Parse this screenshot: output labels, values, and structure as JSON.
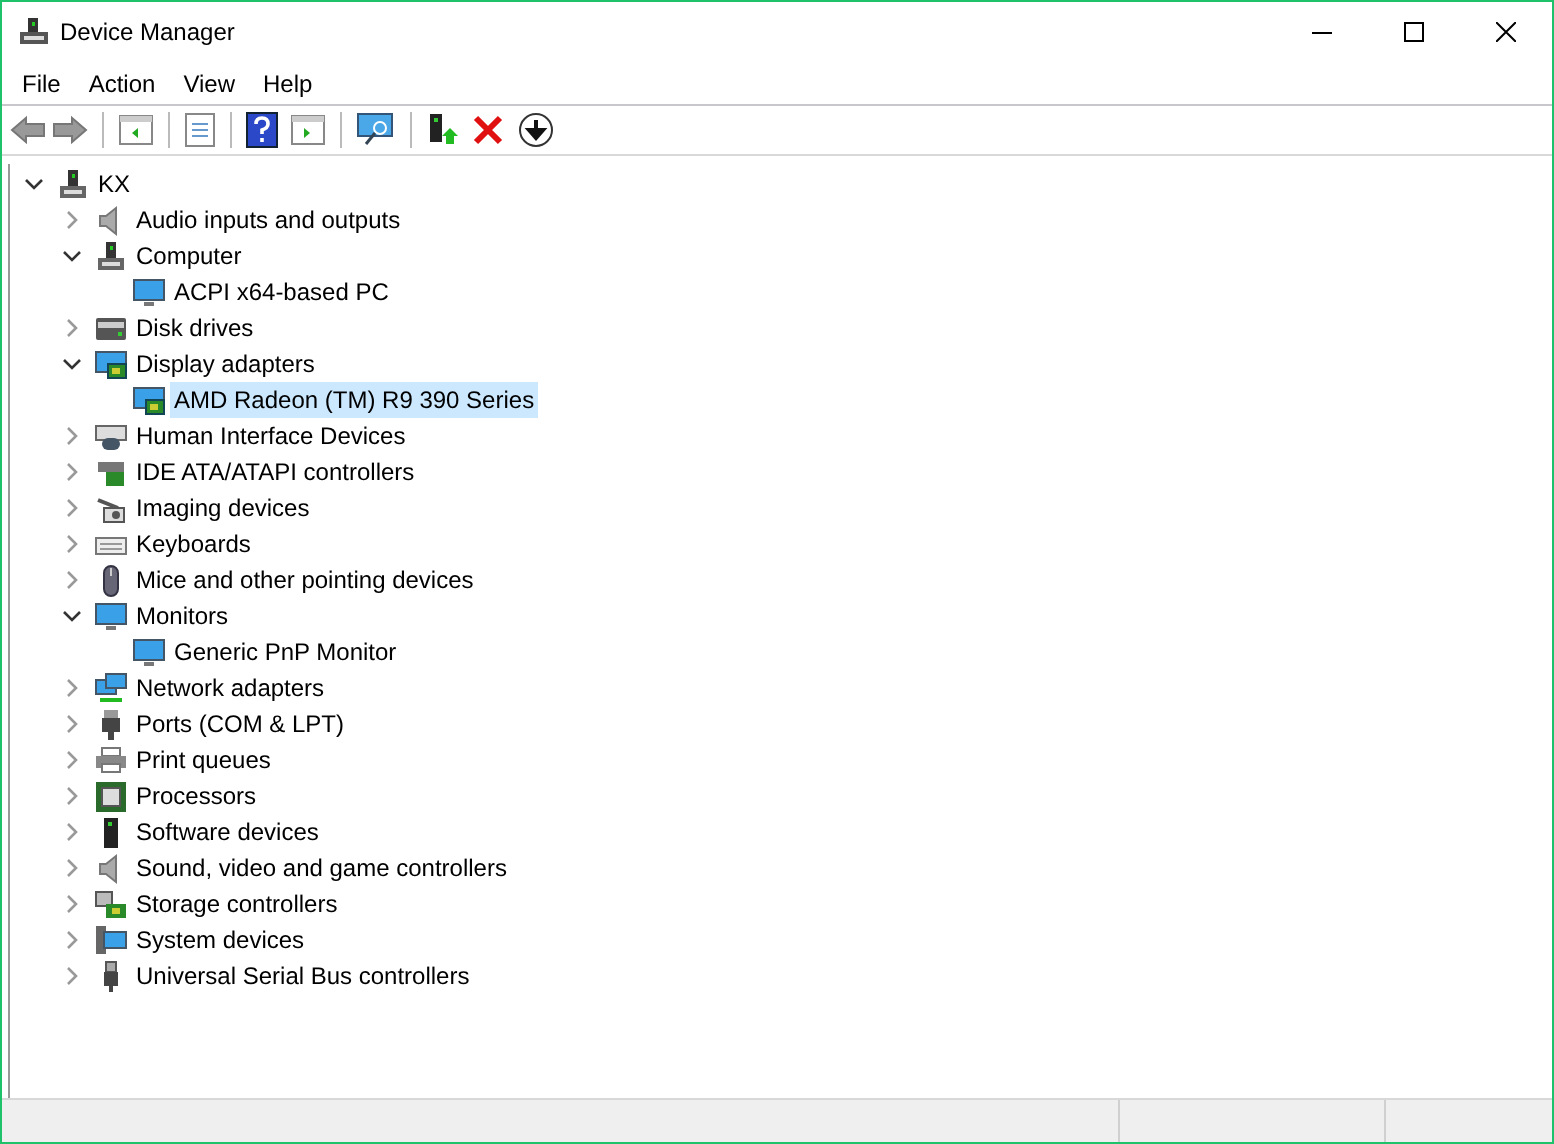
{
  "window": {
    "title": "Device Manager"
  },
  "menu": [
    "File",
    "Action",
    "View",
    "Help"
  ],
  "tree": {
    "label": "KX",
    "expanded": true,
    "selected": false,
    "children": [
      {
        "label": "Audio inputs and outputs",
        "expanded": false,
        "selected": false
      },
      {
        "label": "Computer",
        "expanded": true,
        "selected": false,
        "children": [
          {
            "label": "ACPI x64-based PC",
            "selected": false
          }
        ]
      },
      {
        "label": "Disk drives",
        "expanded": false,
        "selected": false
      },
      {
        "label": "Display adapters",
        "expanded": true,
        "selected": false,
        "children": [
          {
            "label": "AMD Radeon (TM) R9 390 Series",
            "selected": true
          }
        ]
      },
      {
        "label": "Human Interface Devices",
        "expanded": false,
        "selected": false
      },
      {
        "label": "IDE ATA/ATAPI controllers",
        "expanded": false,
        "selected": false
      },
      {
        "label": "Imaging devices",
        "expanded": false,
        "selected": false
      },
      {
        "label": "Keyboards",
        "expanded": false,
        "selected": false
      },
      {
        "label": "Mice and other pointing devices",
        "expanded": false,
        "selected": false
      },
      {
        "label": "Monitors",
        "expanded": true,
        "selected": false,
        "children": [
          {
            "label": "Generic PnP Monitor",
            "selected": false
          }
        ]
      },
      {
        "label": "Network adapters",
        "expanded": false,
        "selected": false
      },
      {
        "label": "Ports (COM & LPT)",
        "expanded": false,
        "selected": false
      },
      {
        "label": "Print queues",
        "expanded": false,
        "selected": false
      },
      {
        "label": "Processors",
        "expanded": false,
        "selected": false
      },
      {
        "label": "Software devices",
        "expanded": false,
        "selected": false
      },
      {
        "label": "Sound, video and game controllers",
        "expanded": false,
        "selected": false
      },
      {
        "label": "Storage controllers",
        "expanded": false,
        "selected": false
      },
      {
        "label": "System devices",
        "expanded": false,
        "selected": false
      },
      {
        "label": "Universal Serial Bus controllers",
        "expanded": false,
        "selected": false
      }
    ]
  }
}
